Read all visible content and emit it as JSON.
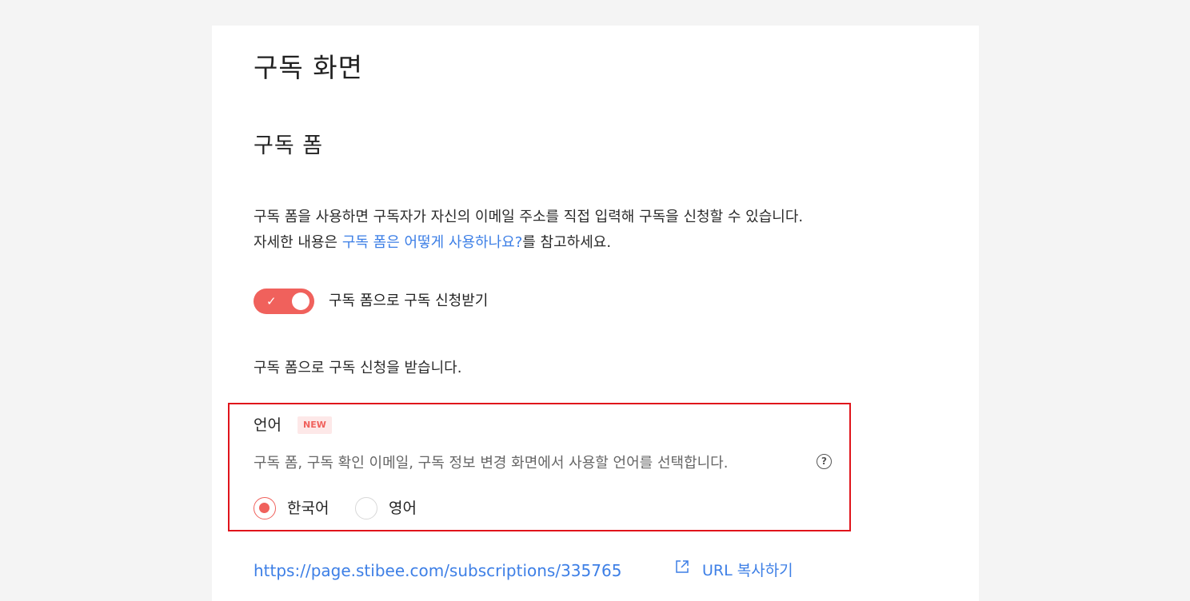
{
  "page": {
    "title": "구독 화면"
  },
  "subscription_form": {
    "section_title": "구독 폼",
    "description_line1": "구독 폼을 사용하면 구독자가 자신의 이메일 주소를 직접 입력해 구독을 신청할 수 있습니다.",
    "description_line2_prefix": "자세한 내용은 ",
    "description_link": "구독 폼은 어떻게 사용하나요?",
    "description_line2_suffix": "를 참고하세요.",
    "toggle": {
      "label": "구독 폼으로 구독 신청받기",
      "enabled": true,
      "icon": "check-icon"
    },
    "status_text": "구독 폼으로 구독 신청을 받습니다."
  },
  "language": {
    "title": "언어",
    "badge": "NEW",
    "description": "구독 폼, 구독 확인 이메일, 구독 정보 변경 화면에서 사용할 언어를 선택합니다.",
    "help_icon": "?",
    "options": [
      {
        "label": "한국어",
        "selected": true
      },
      {
        "label": "영어",
        "selected": false
      }
    ]
  },
  "url": {
    "link": "https://page.stibee.com/subscriptions/335765",
    "icon": "external-link-icon",
    "copy_label": "URL 복사하기"
  },
  "colors": {
    "accent": "#f0615c",
    "link": "#3d7fe6",
    "highlight_border": "#e0141b",
    "background": "#f4f4f4"
  }
}
